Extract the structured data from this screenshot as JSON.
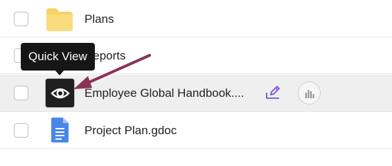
{
  "files": [
    {
      "name": "Plans",
      "type": "folder"
    },
    {
      "name": "Reports",
      "type": "folder"
    },
    {
      "name": "Employee Global Handbook....",
      "type": "document",
      "hovered": true
    },
    {
      "name": "Project Plan.gdoc",
      "type": "google-doc"
    }
  ],
  "tooltip": {
    "text": "Quick View"
  },
  "row_actions": {
    "edit_icon": "edit-icon",
    "stats_icon": "bar-chart-icon"
  },
  "icons": {
    "folder": "folder-icon",
    "quick_view": "eye-icon",
    "google_doc": "google-doc-icon"
  },
  "colors": {
    "folder": "#f7d266",
    "google_doc": "#4a86e8",
    "annotation_arrow": "#8a3357",
    "edit_accent": "#7a4fd0",
    "hover_row": "#efefef"
  }
}
